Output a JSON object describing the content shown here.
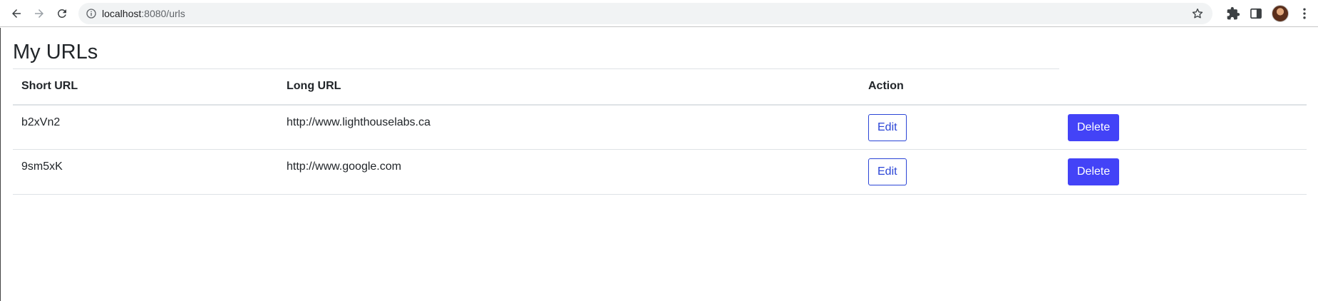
{
  "browser": {
    "url_host": "localhost",
    "url_path": ":8080/urls",
    "icons": {
      "back": "arrow-left-icon",
      "forward": "arrow-right-icon",
      "reload": "reload-icon",
      "info": "info-icon",
      "bookmark": "star-icon",
      "extensions": "puzzle-icon",
      "side_panel": "side-panel-icon",
      "menu": "kebab-menu-icon"
    }
  },
  "page": {
    "title": "My URLs",
    "columns": {
      "short": "Short URL",
      "long": "Long URL",
      "action": "Action"
    },
    "rows": [
      {
        "short": "b2xVn2",
        "long": "http://www.lighthouselabs.ca",
        "edit": "Edit",
        "delete": "Delete"
      },
      {
        "short": "9sm5xK",
        "long": "http://www.google.com",
        "edit": "Edit",
        "delete": "Delete"
      }
    ]
  },
  "colors": {
    "primary_button": "#4343f7",
    "outline_button": "#2b45d6"
  }
}
